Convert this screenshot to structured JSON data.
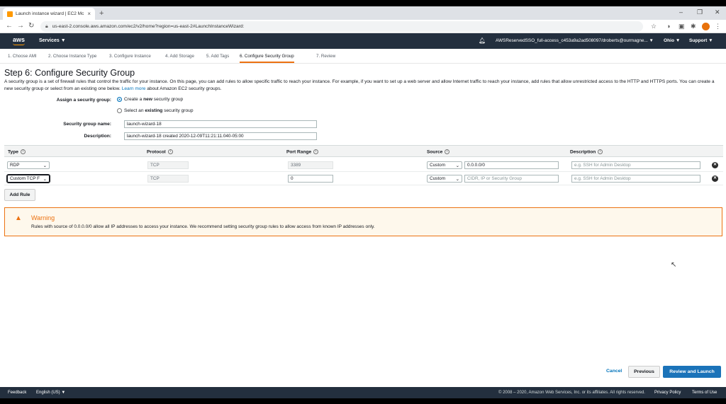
{
  "browser": {
    "tab_title": "Launch instance wizard | EC2 Mc",
    "tab_close": "×",
    "new_tab": "+",
    "url": "us-east-2.console.aws.amazon.com/ec2/v2/home?region=us-east-2#LaunchInstanceWizard:",
    "win_min": "–",
    "win_max": "❐",
    "win_close": "✕"
  },
  "aws_nav": {
    "logo": "aws",
    "services": "Services ▼",
    "account": "AWSReservedSSO_full-access_c453a9a2ad508097/droberts@ourmagne... ▼",
    "region": "Ohio ▼",
    "support": "Support ▼"
  },
  "steps": [
    "1. Choose AMI",
    "2. Choose Instance Type",
    "3. Configure Instance",
    "4. Add Storage",
    "5. Add Tags",
    "6. Configure Security Group",
    "7. Review"
  ],
  "page": {
    "title": "Step 6: Configure Security Group",
    "intro": "A security group is a set of firewall rules that control the traffic for your instance. On this page, you can add rules to allow specific traffic to reach your instance. For example, if you want to set up a web server and allow Internet traffic to reach your instance, add rules that allow unrestricted access to the HTTP and HTTPS ports. You can create a new security group or select from an existing one below.",
    "learn_more": "Learn more",
    "intro_tail": "about Amazon EC2 security groups."
  },
  "form": {
    "assign_label": "Assign a security group:",
    "radio_new_pre": "Create a ",
    "radio_new_bold": "new",
    "radio_new_post": " security group",
    "radio_existing_pre": "Select an ",
    "radio_existing_bold": "existing",
    "radio_existing_post": " security group",
    "name_label": "Security group name:",
    "name_value": "launch-wizard-18",
    "desc_label": "Description:",
    "desc_value": "launch-wizard-18 created 2020-12-09T11:21:11.040-05:00"
  },
  "table": {
    "headers": [
      "Type",
      "Protocol",
      "Port Range",
      "Source",
      "Description"
    ],
    "info_icon": "i",
    "rows": [
      {
        "type": "RDP",
        "protocol": "TCP",
        "port": "3389",
        "source_mode": "Custom",
        "source_value": "0.0.0.0/0",
        "source_placeholder": "",
        "desc_placeholder": "e.g. SSH for Admin Desktop"
      },
      {
        "type": "Custom TCP F",
        "protocol": "TCP",
        "port": "0",
        "source_mode": "Custom",
        "source_value": "",
        "source_placeholder": "CIDR, IP or Security Group",
        "desc_placeholder": "e.g. SSH for Admin Desktop"
      }
    ],
    "remove_icon": "✕",
    "chevron": "⌄"
  },
  "add_rule": "Add Rule",
  "warning": {
    "icon": "▲",
    "title": "Warning",
    "text": "Rules with source of 0.0.0.0/0 allow all IP addresses to access your instance. We recommend setting security group rules to allow access from known IP addresses only."
  },
  "actions": {
    "cancel": "Cancel",
    "previous": "Previous",
    "review_launch": "Review and Launch"
  },
  "footer": {
    "feedback": "Feedback",
    "language": "English (US) ▼",
    "copyright": "© 2008 – 2020, Amazon Web Services, Inc. or its affiliates. All rights reserved.",
    "privacy": "Privacy Policy",
    "terms": "Terms of Use"
  },
  "colors": {
    "aws_nav": "#232f3e",
    "accent_orange": "#ec7211",
    "link_blue": "#0073bb",
    "primary_button": "#1b73b9"
  }
}
